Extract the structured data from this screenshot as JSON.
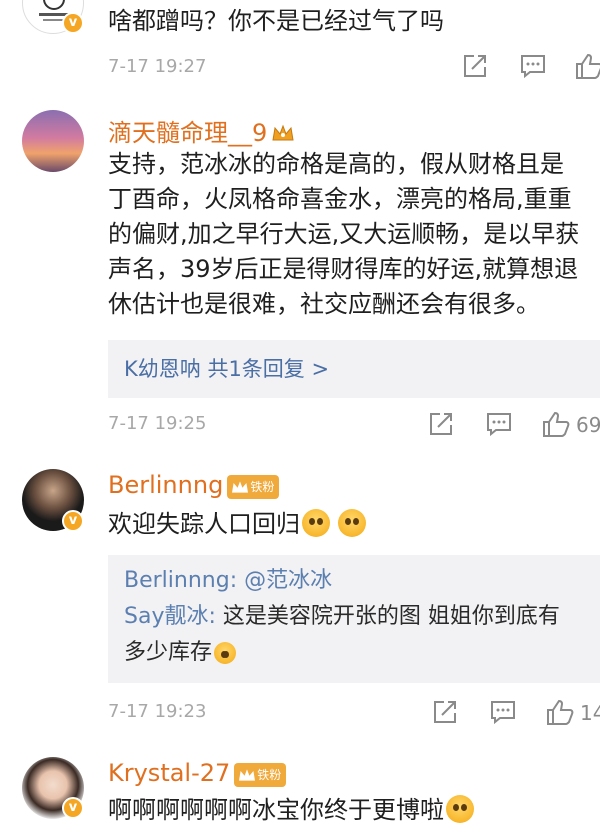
{
  "comments": [
    {
      "text": "啥都蹭吗？你不是已经过气了吗",
      "time": "7-17 19:27"
    },
    {
      "username": "滴天髓命理__9",
      "text_lines": [
        "支持，范冰冰的命格是高的，假从财格且是",
        "丁酉命，火凤格命喜金水，漂亮的格局,重重",
        "的偏财,加之早行大运,又大运顺畅，是以早获",
        "声名，39岁后正是得财得库的好运,就算想退",
        "休估计也是很难，社交应酬还会有很多。"
      ],
      "reply_link": "K幼恩呐  共1条回复 >",
      "time": "7-17 19:25",
      "likes": "69"
    },
    {
      "username": "Berlinnng",
      "fan_badge": "铁粉",
      "text": "欢迎失踪人口回归",
      "replies": [
        {
          "name": "Berlinnng:",
          "text": " @范冰冰"
        },
        {
          "name": "Say靓冰:",
          "text": " 这是美容院开张的图 姐姐你到底有"
        },
        {
          "name": "",
          "text": "多少库存"
        }
      ],
      "time": "7-17 19:23",
      "likes": "14"
    },
    {
      "username": "Krystal-27",
      "fan_badge": "铁粉",
      "text": "啊啊啊啊啊啊冰宝你终于更博啦"
    }
  ],
  "icons": [
    "share-icon",
    "comment-icon",
    "like-icon",
    "crown-icon",
    "verified-badge-icon",
    "emoji-icon"
  ],
  "colors": {
    "username": "#e0701f",
    "reply_name": "#5b7fb0",
    "meta": "#a8a8a8",
    "reply_bg": "#f2f2f4",
    "badge": "#f5a623"
  }
}
